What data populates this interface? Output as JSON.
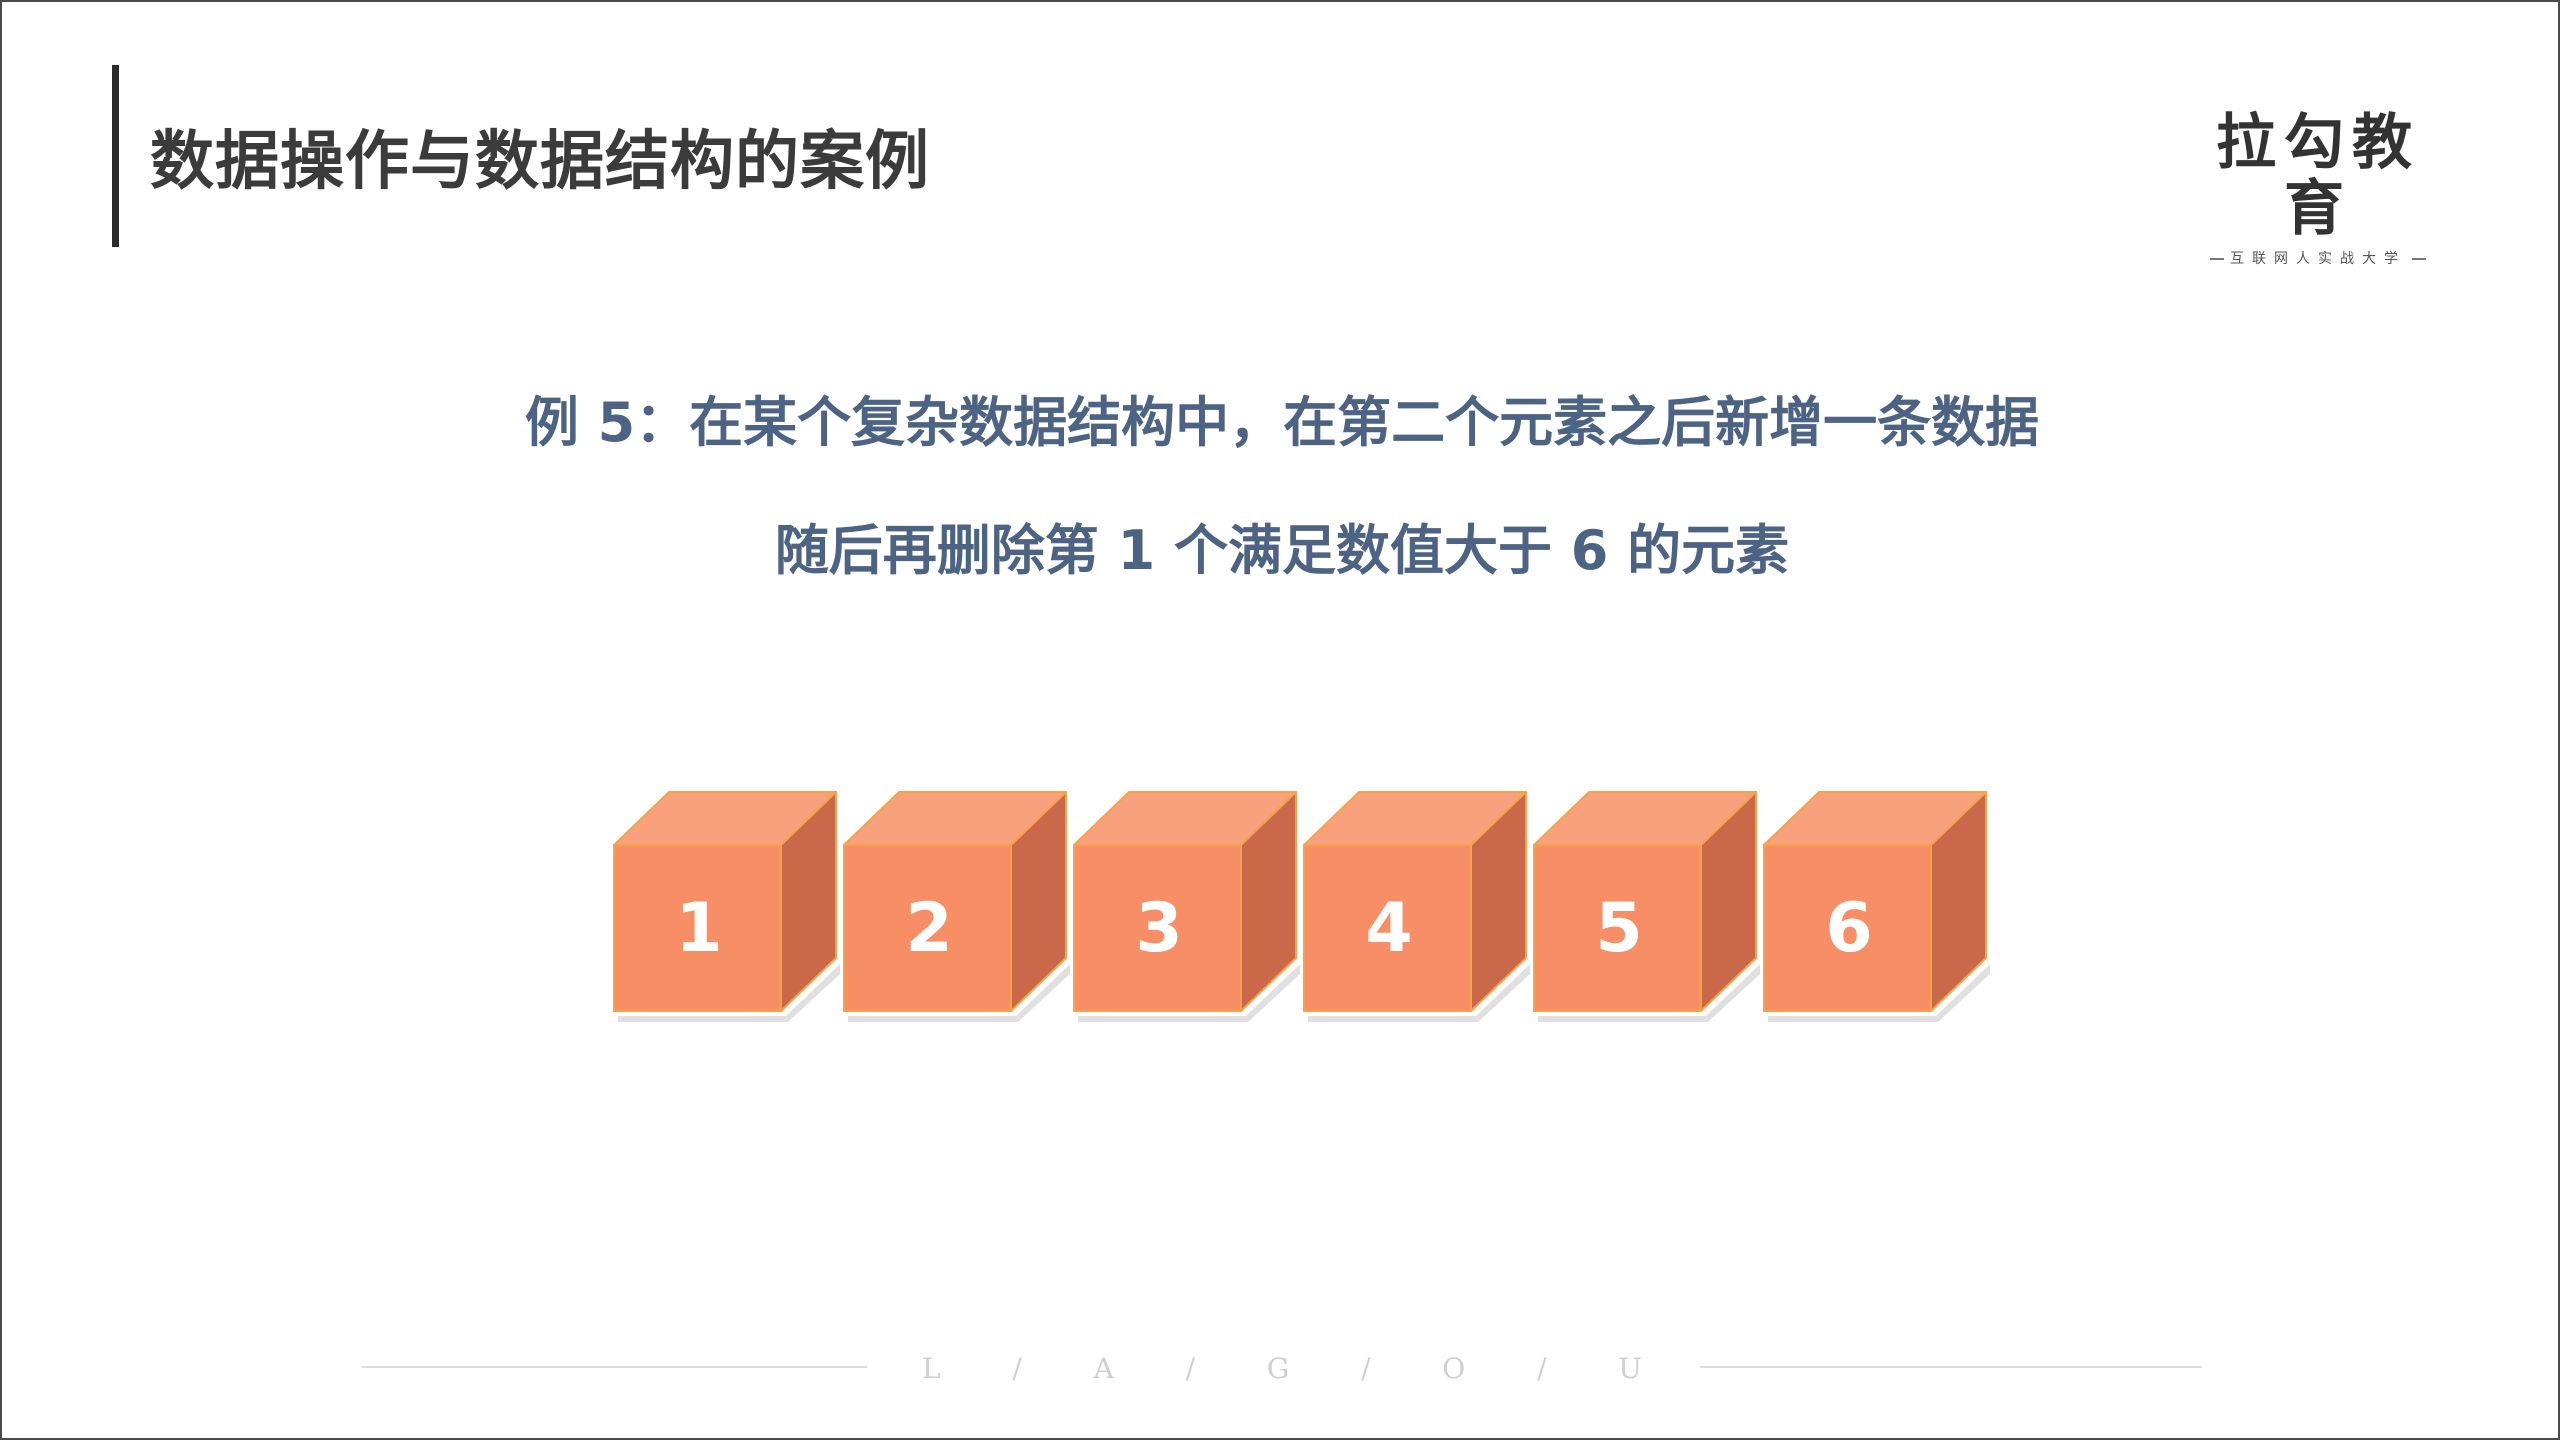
{
  "header": {
    "title": "数据操作与数据结构的案例"
  },
  "logo": {
    "name": "拉勾教育",
    "slogan": "互联网人实战大学"
  },
  "example": {
    "line1": "例 5：在某个复杂数据结构中，在第二个元素之后新增一条数据",
    "line2": "随后再删除第 1 个满足数值大于 6 的元素"
  },
  "cubes": [
    "1",
    "2",
    "3",
    "4",
    "5",
    "6"
  ],
  "colors": {
    "title_text": "#3b3b3b",
    "example_text": "#4d6384",
    "cube_front": "#f88e65",
    "cube_top": "#f9a07d",
    "cube_side": "#c9694a",
    "cube_edge": "#f5a34a"
  },
  "footer": {
    "letters": [
      "L",
      "/",
      "A",
      "/",
      "G",
      "/",
      "O",
      "/",
      "U"
    ]
  }
}
